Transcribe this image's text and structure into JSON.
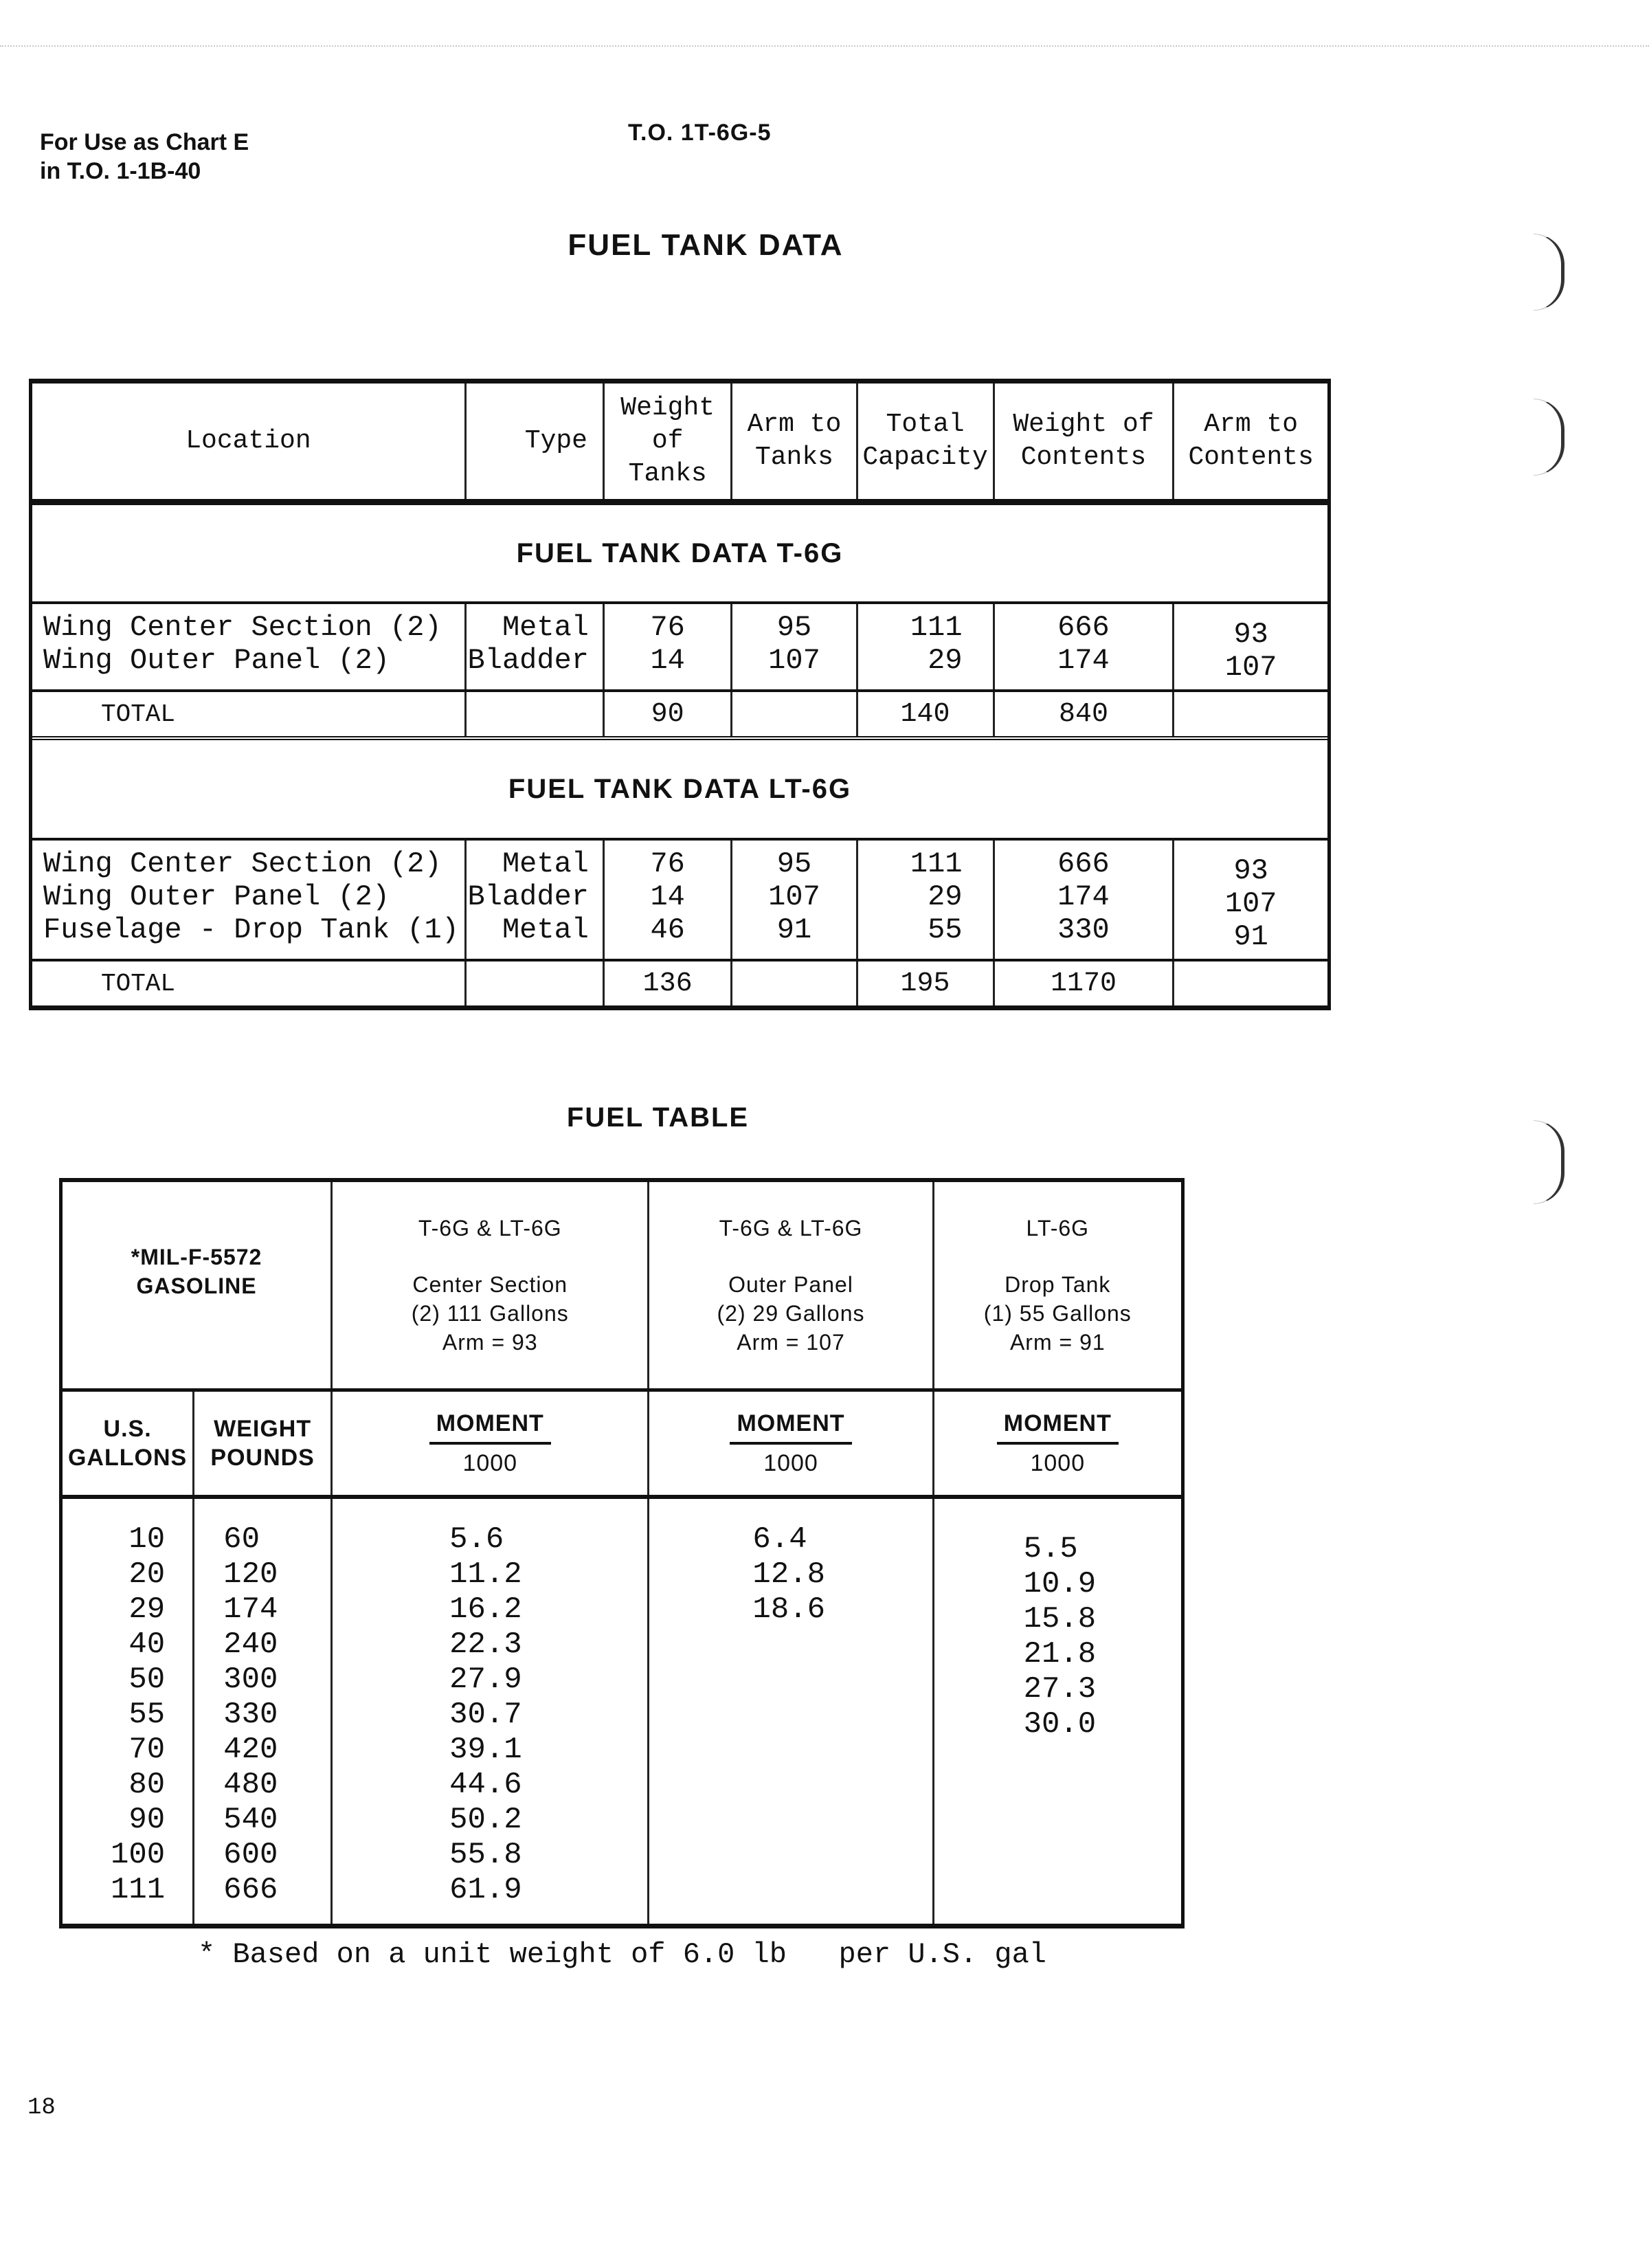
{
  "header": {
    "left_line1": "For Use as Chart E",
    "left_line2": "in T.O. 1-1B-40",
    "center": "T.O. 1T-6G-5"
  },
  "fuel_tank_data": {
    "title": "FUEL TANK DATA",
    "columns": [
      "Location",
      "Type",
      "Weight of Tanks",
      "Arm to Tanks",
      "Total Capacity",
      "Weight of Contents",
      "Arm to Contents"
    ],
    "column_lines": [
      [
        "Location"
      ],
      [
        "Type"
      ],
      [
        "Weight",
        "of",
        "Tanks"
      ],
      [
        "Arm to",
        "Tanks"
      ],
      [
        "Total",
        "Capacity"
      ],
      [
        "Weight of",
        "Contents"
      ],
      [
        "Arm to",
        "Contents"
      ]
    ],
    "sections": [
      {
        "heading": "FUEL TANK DATA T-6G",
        "rows": [
          {
            "location": "Wing Center Section (2)",
            "type": "Metal",
            "weight_of_tanks": "76",
            "arm_to_tanks": "95",
            "total_capacity": "111",
            "weight_of_contents": "666",
            "arm_to_contents": "93"
          },
          {
            "location": "Wing Outer Panel (2)",
            "type": "Bladder",
            "weight_of_tanks": "14",
            "arm_to_tanks": "107",
            "total_capacity": "29",
            "weight_of_contents": "174",
            "arm_to_contents": "107"
          }
        ],
        "total": {
          "label": "TOTAL",
          "weight_of_tanks": "90",
          "arm_to_tanks": "",
          "total_capacity": "140",
          "weight_of_contents": "840",
          "arm_to_contents": ""
        }
      },
      {
        "heading": "FUEL TANK DATA LT-6G",
        "rows": [
          {
            "location": "Wing Center Section (2)",
            "type": "Metal",
            "weight_of_tanks": "76",
            "arm_to_tanks": "95",
            "total_capacity": "111",
            "weight_of_contents": "666",
            "arm_to_contents": "93"
          },
          {
            "location": "Wing Outer Panel (2)",
            "type": "Bladder",
            "weight_of_tanks": "14",
            "arm_to_tanks": "107",
            "total_capacity": "29",
            "weight_of_contents": "174",
            "arm_to_contents": "107"
          },
          {
            "location": "Fuselage - Drop Tank (1)",
            "type": "Metal",
            "weight_of_tanks": "46",
            "arm_to_tanks": "91",
            "total_capacity": "55",
            "weight_of_contents": "330",
            "arm_to_contents": "91"
          }
        ],
        "total": {
          "label": "TOTAL",
          "weight_of_tanks": "136",
          "arm_to_tanks": "",
          "total_capacity": "195",
          "weight_of_contents": "1170",
          "arm_to_contents": ""
        }
      }
    ]
  },
  "fuel_table": {
    "title": "FUEL TABLE",
    "fuel_spec": {
      "line1": "*MIL-F-5572",
      "line2": "GASOLINE"
    },
    "tank_columns": [
      {
        "model": "T-6G & LT-6G",
        "name": "Center Section",
        "capacity": "(2) 111 Gallons",
        "arm": "Arm = 93"
      },
      {
        "model": "T-6G & LT-6G",
        "name": "Outer Panel",
        "capacity": "(2) 29 Gallons",
        "arm": "Arm = 107"
      },
      {
        "model": "LT-6G",
        "name": "Drop Tank",
        "capacity": "(1) 55 Gallons",
        "arm": "Arm = 91"
      }
    ],
    "sub_headers": {
      "gallons": [
        "U.S.",
        "GALLONS"
      ],
      "weight": [
        "WEIGHT",
        "POUNDS"
      ],
      "moment_numerator": "MOMENT",
      "moment_denominator": "1000"
    },
    "us_gallons": [
      "10",
      "20",
      "29",
      "40",
      "50",
      "55",
      "70",
      "80",
      "90",
      "100",
      "111"
    ],
    "weight_pounds": [
      "60",
      "120",
      "174",
      "240",
      "300",
      "330",
      "420",
      "480",
      "540",
      "600",
      "666"
    ],
    "moment_center_section": [
      "5.6",
      "11.2",
      "16.2",
      "22.3",
      "27.9",
      "30.7",
      "39.1",
      "44.6",
      "50.2",
      "55.8",
      "61.9"
    ],
    "moment_outer_panel": [
      "6.4",
      "12.8",
      "18.6"
    ],
    "moment_drop_tank": [
      "5.5",
      "10.9",
      "15.8",
      "21.8",
      "27.3",
      "30.0"
    ]
  },
  "footnote": "* Based on a unit weight of 6.0 lb   per U.S. gal",
  "page_number": "18"
}
